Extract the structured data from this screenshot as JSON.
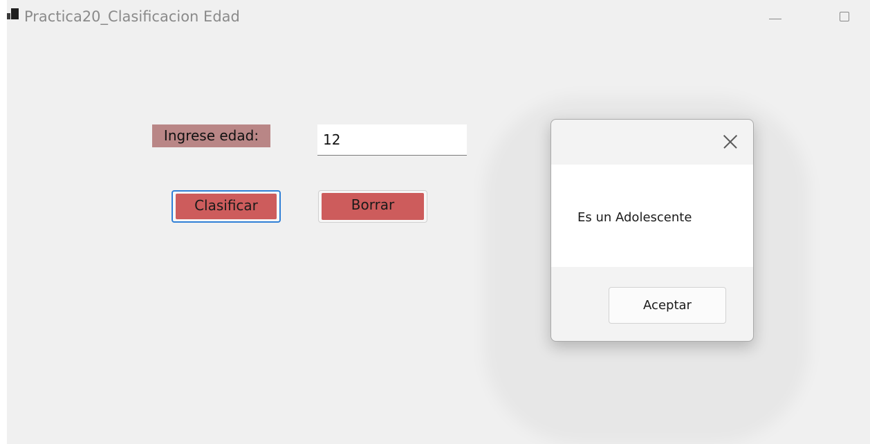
{
  "window": {
    "title": "Practica20_Clasificacion Edad",
    "icon": "app-icon",
    "minimize_icon": "minimize-icon",
    "maximize_icon": "maximize-icon"
  },
  "form": {
    "age_label": "Ingrese edad:",
    "age_value": "12",
    "classify_button": "Clasificar",
    "clear_button": "Borrar"
  },
  "dialog": {
    "close_icon": "close-icon",
    "message": "Es un Adolescente",
    "ok_button": "Aceptar"
  },
  "colors": {
    "window_background": "#f0f0f0",
    "label_background": "#b98686",
    "button_face": "#cd5c5c",
    "focus_border": "#2f7fd6"
  }
}
